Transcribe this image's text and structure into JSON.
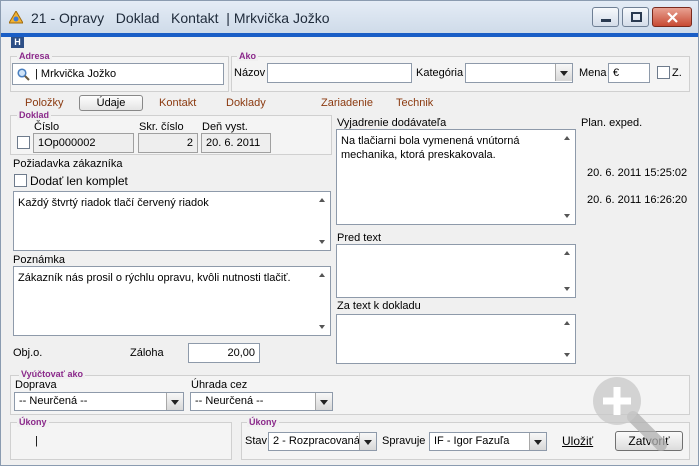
{
  "window": {
    "title": "21 - Opravy   Doklad   Kontakt  | Mrkvička Jožko",
    "badge": "H"
  },
  "adresa": {
    "label": "Adresa",
    "value": "| Mrkvička Jožko"
  },
  "ako": {
    "label": "Ako",
    "nazov_label": "Názov",
    "nazov_value": "",
    "kategoria_label": "Kategória",
    "kategoria_value": "",
    "mena_label": "Mena",
    "mena_value": "€",
    "z_label": "Z."
  },
  "tabs": [
    {
      "label": "Položky",
      "active": false
    },
    {
      "label": "Údaje",
      "active": true
    },
    {
      "label": "Kontakt",
      "active": false
    },
    {
      "label": "Doklady",
      "active": false
    },
    {
      "label": "Zariadenie",
      "active": false
    },
    {
      "label": "Technik",
      "active": false
    }
  ],
  "doklad": {
    "label": "Doklad",
    "cislo_label": "Číslo",
    "cislo_value": "1Op000002",
    "skr_label": "Skr. číslo",
    "skr_value": "2",
    "den_label": "Deň vyst.",
    "den_value": "20. 6. 2011"
  },
  "poziadavka": {
    "label": "Požiadavka zákazníka",
    "dodat_label": "Dodať len komplet",
    "text": "Každý štvrtý riadok tlačí červený riadok"
  },
  "poznamka": {
    "label": "Poznámka",
    "text": "Zákazník nás prosil o rýchlu opravu, kvôli nutnosti tlačiť."
  },
  "objo_label": "Obj.o.",
  "zaloha": {
    "label": "Záloha",
    "value": "20,00"
  },
  "vyjadrenie": {
    "label": "Vyjadrenie dodávateľa",
    "text": "Na tlačiarni bola vymenená vnútorná mechanika, ktorá preskakovala."
  },
  "pred_text_label": "Pred text",
  "za_text_label": "Za text k dokladu",
  "plan": {
    "label": "Plan. exped.",
    "date1": "20. 6. 2011 15:25:02",
    "date2": "20. 6. 2011 16:26:20"
  },
  "vyuctovat": {
    "label": "Vyúčtovať ako",
    "doprava_label": "Doprava",
    "doprava_value": "-- Neurčená --",
    "uhrada_label": "Úhrada cez",
    "uhrada_value": "-- Neurčená --"
  },
  "ukony_left": {
    "label": "Úkony",
    "value": "|"
  },
  "ukony_right": {
    "label": "Úkony",
    "stav_label": "Stav",
    "stav_value": "2 - Rozpracovaná",
    "spravuje_label": "Spravuje",
    "spravuje_value": "IF - Igor Fazuľa"
  },
  "buttons": {
    "ulozit": "Uložiť",
    "zatvorit": "Zatvoriť"
  },
  "colors": {
    "accent": "#1a5ec6",
    "group_label": "#8b2a8b",
    "tab_text": "#8b3a10"
  }
}
